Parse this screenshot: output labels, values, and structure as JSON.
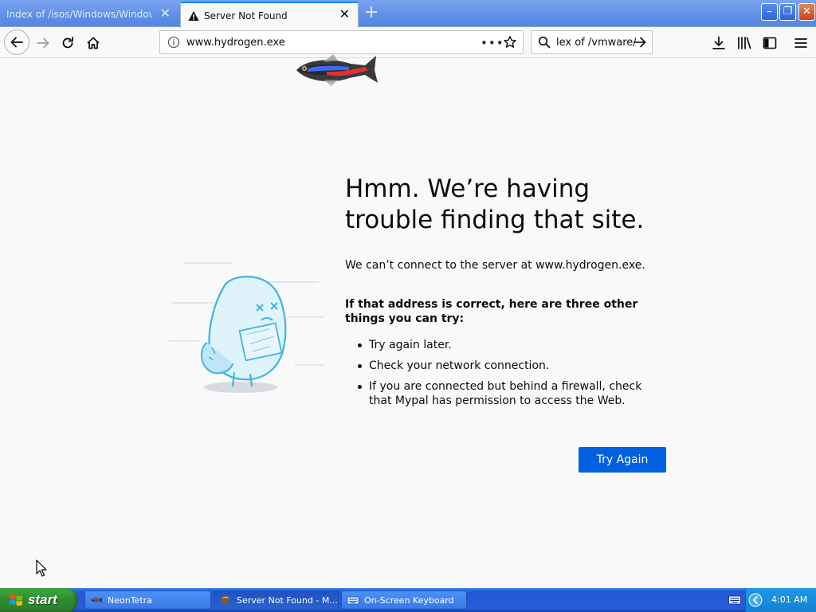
{
  "tabs": [
    {
      "title": "Index of /isos/Windows/Windows_Vist",
      "active": false
    },
    {
      "title": "Server Not Found",
      "active": true
    }
  ],
  "new_tab_symbol": "+",
  "window_controls": {
    "minimize": "–",
    "maximize": "❐",
    "close": "✕"
  },
  "toolbar": {
    "url": "www.hydrogen.exe",
    "page_actions": "•••",
    "search_text": "lex of /vmware/"
  },
  "error_page": {
    "title": "Hmm. We’re having trouble finding that site.",
    "description": "We can’t connect to the server at www.hydrogen.exe.",
    "tips_heading": "If that address is correct, here are three other things you can try:",
    "tips": [
      "Try again later.",
      "Check your network connection.",
      "If you are connected but behind a firewall, check that Mypal has permission to access the Web."
    ],
    "try_again_label": "Try Again"
  },
  "taskbar": {
    "start_label": "start",
    "tasks": [
      {
        "label": "NeonTetra",
        "active": false
      },
      {
        "label": "Server Not Found - M...",
        "active": true
      },
      {
        "label": "On-Screen Keyboard",
        "active": false
      }
    ],
    "clock": "4:01 AM"
  },
  "colors": {
    "accent": "#0a84ff",
    "button": "#0060df",
    "page_background": "#f9f9fa",
    "taskbar": "#245ddb",
    "start_button": "#2e8b2e"
  }
}
